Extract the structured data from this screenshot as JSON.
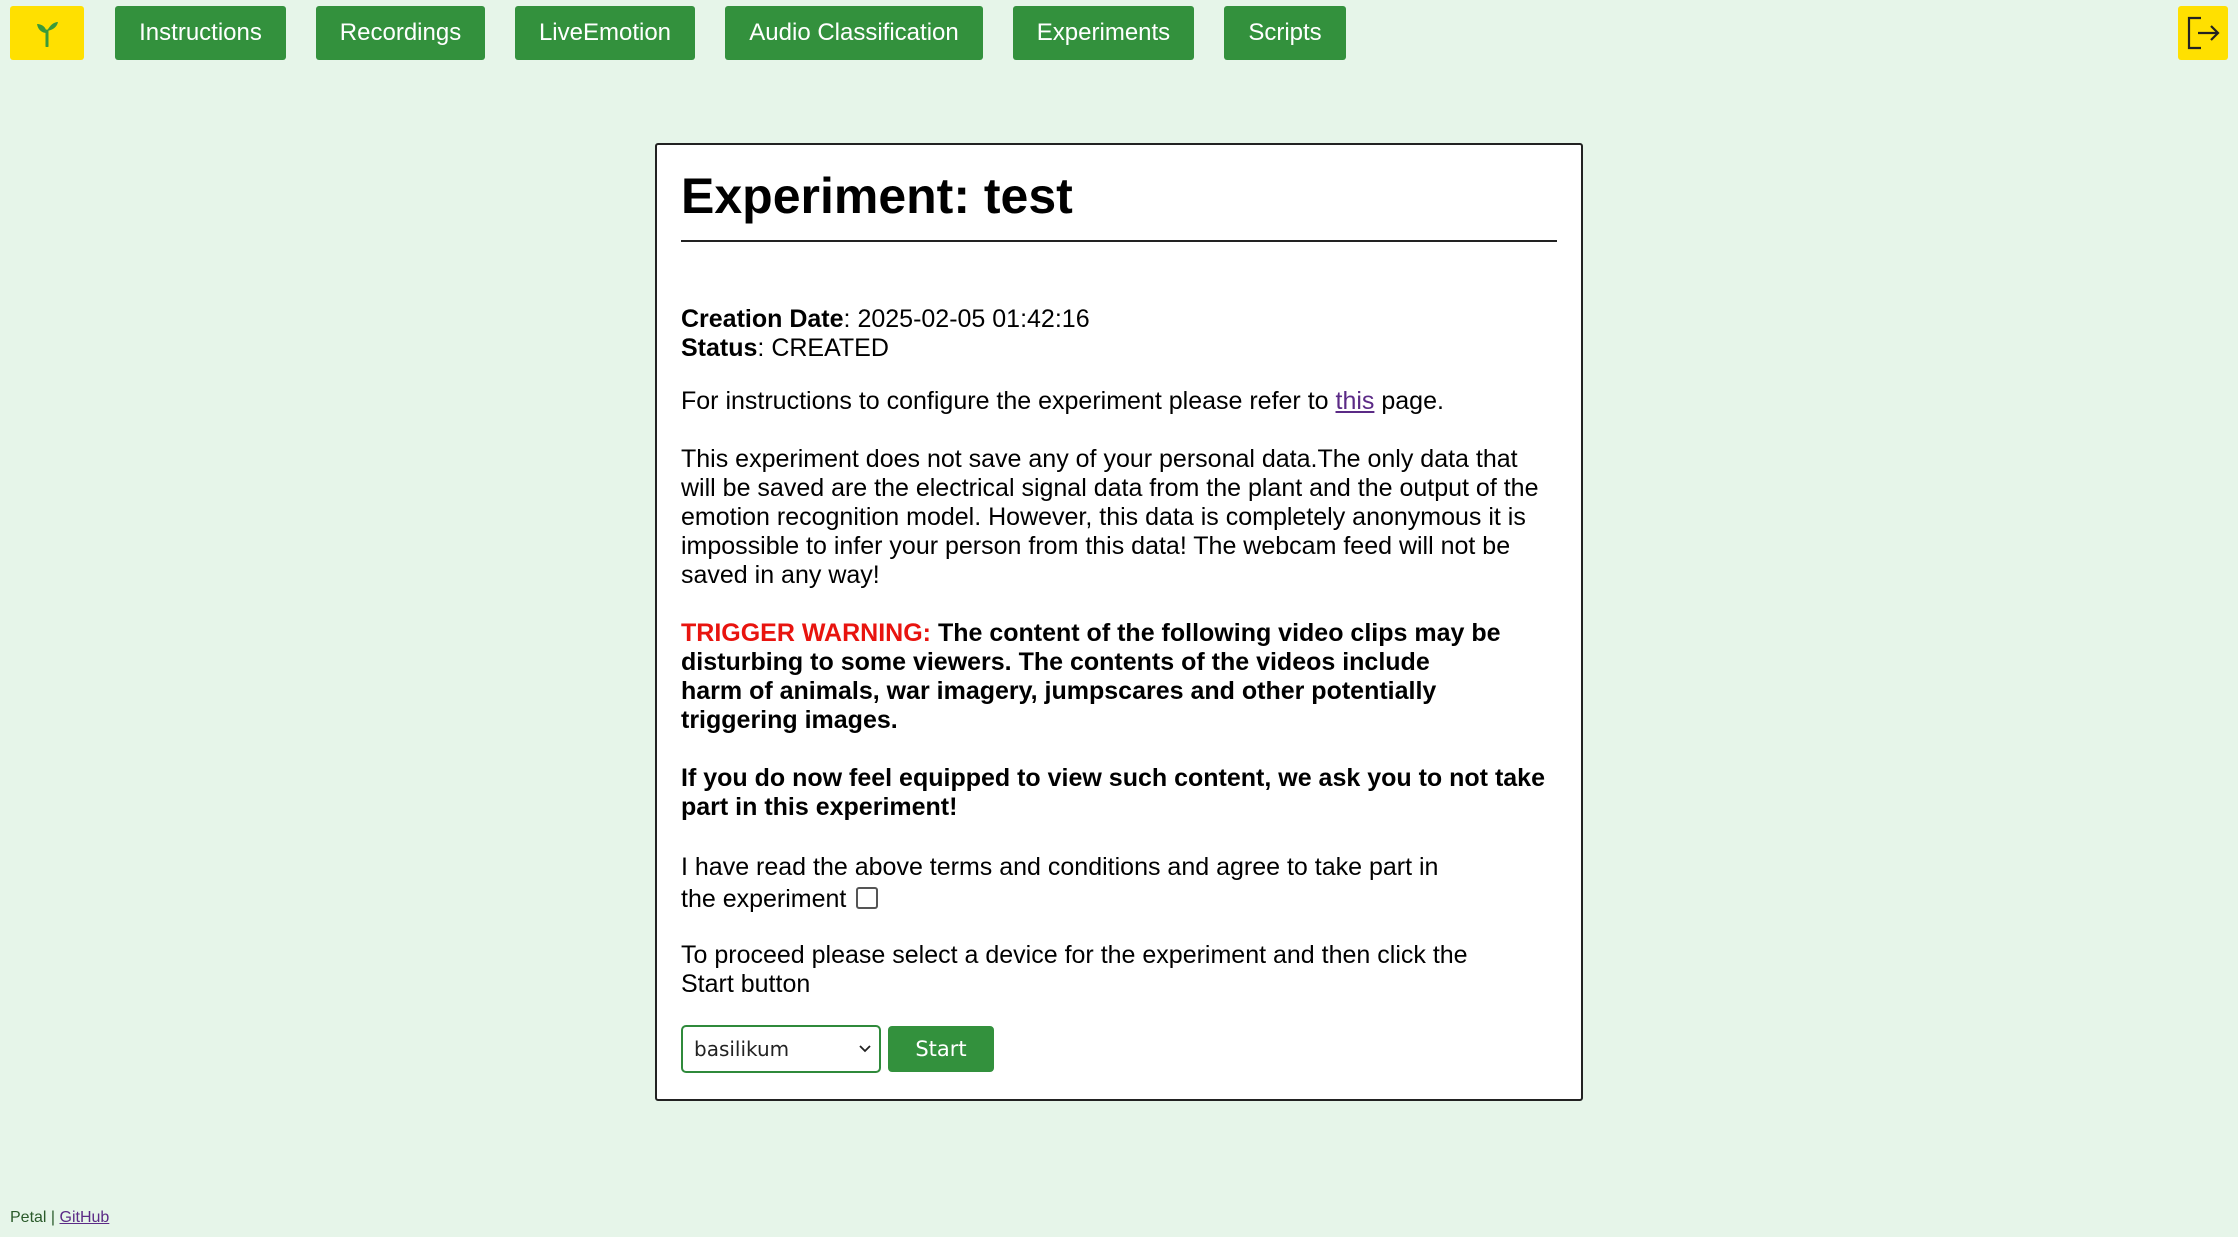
{
  "nav": {
    "logo_icon": "sprout-icon",
    "items": [
      {
        "label": "Instructions"
      },
      {
        "label": "Recordings"
      },
      {
        "label": "LiveEmotion"
      },
      {
        "label": "Audio Classification"
      },
      {
        "label": "Experiments"
      },
      {
        "label": "Scripts"
      }
    ],
    "logout_icon": "logout-icon",
    "colors": {
      "button": "#33913d",
      "logo_bg": "#ffe000",
      "page_bg": "#e6f5e9"
    }
  },
  "experiment": {
    "title": "Experiment: test",
    "creation_date_label": "Creation Date",
    "creation_date": "2025-02-05 01:42:16",
    "status_label": "Status",
    "status": "CREATED",
    "instructions_prefix": "For instructions to configure the experiment please refer to ",
    "instructions_link": "this",
    "instructions_suffix": " page.",
    "privacy_text": "This experiment does not save any of your personal data.The only data that will be saved are the electrical signal data from the plant and the output of the emotion recognition model. However, this data is completely anonymous it is impossible to infer your person from this data! The webcam feed will not be saved in any way!",
    "trigger_label": "TRIGGER WARNING:",
    "trigger_text_line1": " The content of the following video clips may be disturbing to some viewers. The contents of the videos include",
    "trigger_text_line2": "harm of animals, war imagery, jumpscares and other potentially triggering images.",
    "feel_text": "If you do now feel equipped to view such content, we ask you to not take part in this experiment!",
    "agree_text": "I have read the above terms and conditions and agree to take part in the experiment",
    "agree_checked": false,
    "proceed_text": "To proceed please select a device for the experiment and then click the Start button",
    "device_selected": "basilikum",
    "start_label": "Start"
  },
  "footer": {
    "brand": "Petal",
    "separator": " | ",
    "link": "GitHub"
  }
}
